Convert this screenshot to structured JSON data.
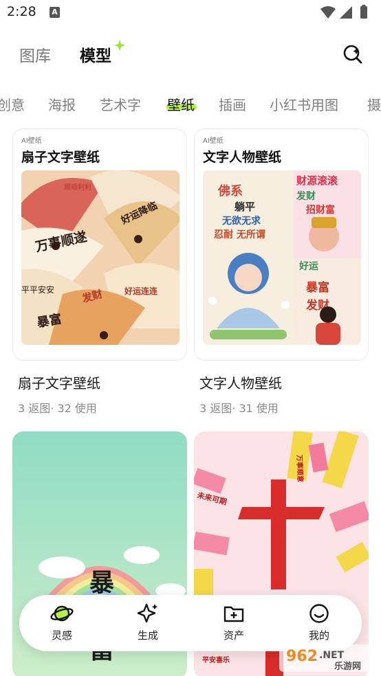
{
  "status": {
    "time": "2:28",
    "badge": "A"
  },
  "header": {
    "tabs": [
      "图库",
      "模型"
    ]
  },
  "categories": [
    "创意",
    "海报",
    "艺术字",
    "壁纸",
    "插画",
    "小红书用图",
    "摄"
  ],
  "cards": [
    {
      "sub": "AI壁纸",
      "head": "扇子文字壁纸",
      "title": "扇子文字壁纸",
      "meta": "3 返图· 32 使用",
      "art_text": [
        "顺顺利利",
        "万事顺遂",
        "好运降临",
        "暴富",
        "平平安安",
        "发财",
        "好运连连"
      ]
    },
    {
      "sub": "AI壁纸",
      "head": "文字人物壁纸",
      "title": "文字人物壁纸",
      "meta": "3 返图· 31 使用",
      "art_text": [
        "佛系",
        "躺平",
        "无欲无求",
        "忍耐 无所谓",
        "财源滚滚",
        "发财",
        "招财富",
        "好运",
        "暴富",
        "发财"
      ]
    }
  ],
  "big_cards": [
    {
      "art_text": [
        "暴",
        "富"
      ]
    },
    {
      "art_text": [
        "上上",
        "万事顺意",
        "未来可期",
        "平安喜乐"
      ]
    }
  ],
  "bottom_nav": [
    {
      "label": "灵感",
      "icon": "planet-icon"
    },
    {
      "label": "生成",
      "icon": "sparkle-icon"
    },
    {
      "label": "资产",
      "icon": "folder-add-icon"
    },
    {
      "label": "我的",
      "icon": "face-icon"
    }
  ],
  "watermark": {
    "number": "962",
    "suffix": ".NET",
    "name": "乐游网"
  },
  "colors": {
    "accent": "#b5f246",
    "text": "#1a1a1a",
    "muted": "#8a8a8a"
  }
}
